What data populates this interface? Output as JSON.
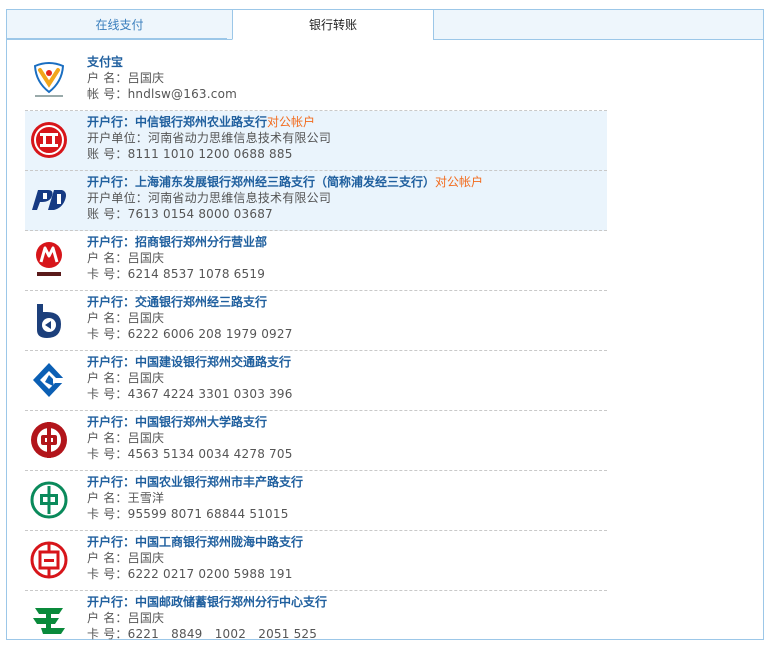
{
  "tabs": {
    "online": "在线支付",
    "bank": "银行转账"
  },
  "accounts": [
    {
      "title": "支付宝",
      "tag": "",
      "l2_label": "户 名：",
      "l2_value": "吕国庆",
      "l3_label": "帐 号：",
      "l3_value": "hndlsw@163.com",
      "highlight": false,
      "logo": "alipay-logo",
      "logo_color": "#1a6ec1"
    },
    {
      "title": "开户行：中信银行郑州农业路支行",
      "tag": "对公帐户",
      "l2_label": "开户单位：",
      "l2_value": "河南省动力思维信息技术有限公司",
      "l3_label": "账 号：",
      "l3_value": "8111 1010 1200 0688 885",
      "highlight": true,
      "logo": "citic-bank-logo",
      "logo_color": "#d7151a"
    },
    {
      "title": "开户行：上海浦东发展银行郑州经三路支行（简称浦发经三支行）",
      "tag": "对公帐户",
      "l2_label": "开户单位：",
      "l2_value": "河南省动力思维信息技术有限公司",
      "l3_label": "账 号：",
      "l3_value": "7613 0154 8000 03687",
      "highlight": true,
      "logo": "spdb-logo",
      "logo_color": "#163a83"
    },
    {
      "title": "开户行：招商银行郑州分行营业部",
      "tag": "",
      "l2_label": "户 名：",
      "l2_value": "吕国庆",
      "l3_label": "卡 号：",
      "l3_value": "6214 8537 1078 6519",
      "highlight": false,
      "logo": "cmb-logo",
      "logo_color": "#d7151a"
    },
    {
      "title": "开户行：交通银行郑州经三路支行",
      "tag": "",
      "l2_label": "户 名：",
      "l2_value": "吕国庆",
      "l3_label": "卡 号：",
      "l3_value": "6222 6006 208 1979 0927",
      "highlight": false,
      "logo": "bocom-logo",
      "logo_color": "#1c3f7b"
    },
    {
      "title": "开户行：中国建设银行郑州交通路支行",
      "tag": "",
      "l2_label": "户 名：",
      "l2_value": "吕国庆",
      "l3_label": "卡 号：",
      "l3_value": "4367 4224 3301 0303 396",
      "highlight": false,
      "logo": "ccb-logo",
      "logo_color": "#0b5fb4"
    },
    {
      "title": "开户行：中国银行郑州大学路支行",
      "tag": "",
      "l2_label": "户 名：",
      "l2_value": "吕国庆",
      "l3_label": "卡 号：",
      "l3_value": "4563 5134 0034 4278 705",
      "highlight": false,
      "logo": "boc-logo",
      "logo_color": "#b2151b"
    },
    {
      "title": "开户行：中国农业银行郑州市丰产路支行",
      "tag": "",
      "l2_label": "户 名：",
      "l2_value": "王雪洋",
      "l3_label": "卡 号：",
      "l3_value": "95599 8071 68844 51015",
      "highlight": false,
      "logo": "abc-logo",
      "logo_color": "#0a8a5b"
    },
    {
      "title": "开户行：中国工商银行郑州陇海中路支行",
      "tag": "",
      "l2_label": "户 名：",
      "l2_value": "吕国庆",
      "l3_label": "卡 号：",
      "l3_value": "6222 0217 0200 5988 191",
      "highlight": false,
      "logo": "icbc-logo",
      "logo_color": "#d7151a"
    },
    {
      "title": "开户行：中国邮政储蓄银行郑州分行中心支行",
      "tag": "",
      "l2_label": "户 名：",
      "l2_value": "吕国庆",
      "l3_label": "卡 号：",
      "l3_value": "6221　8849　1002　2051 525",
      "highlight": false,
      "logo": "psbc-logo",
      "logo_color": "#0a8a3b"
    }
  ]
}
